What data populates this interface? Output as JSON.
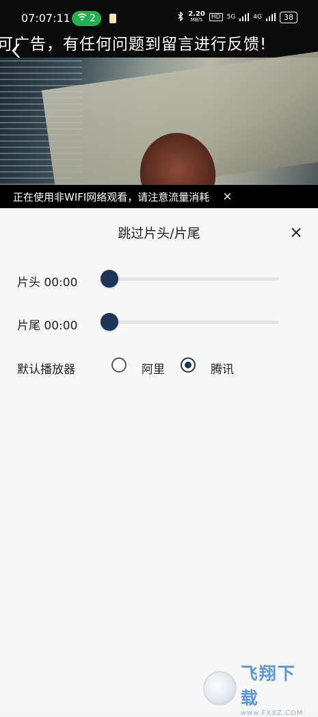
{
  "status_bar": {
    "time": "07:07:11",
    "hotspot_count": "2",
    "net_speed": "2.20",
    "net_unit": "MB/S",
    "hd_label": "HD",
    "signal1": "5G",
    "signal2": "4G",
    "battery": "38"
  },
  "video": {
    "ad_text": "可广告，有任何问题到留言进行反馈!",
    "network_warning": "正在使用非WIFI网络观看，请注意流量消耗",
    "warning_close": "×"
  },
  "panel": {
    "title": "跳过片头/片尾",
    "close": "×",
    "intro_label": "片头 00:00",
    "intro_value": 0,
    "outro_label": "片尾 00:00",
    "outro_value": 0,
    "player_label": "默认播放器",
    "options": [
      {
        "label": "阿里",
        "selected": false
      },
      {
        "label": "腾讯",
        "selected": true
      }
    ],
    "accent_color": "#1d3558"
  },
  "watermark": {
    "title": "飞翔下载",
    "url": "www.FXXZ.COM"
  }
}
